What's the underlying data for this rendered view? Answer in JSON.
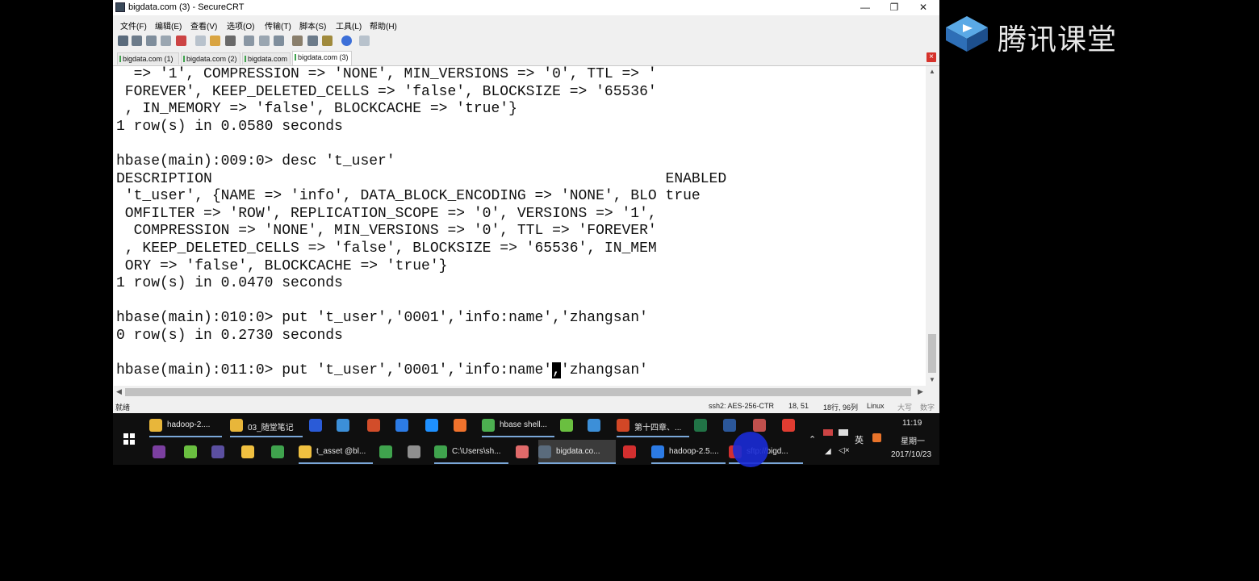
{
  "window": {
    "title": "bigdata.com (3) - SecureCRT",
    "controls": {
      "minimize": "—",
      "maximize": "❐",
      "close": "✕"
    }
  },
  "menu": [
    "文件(F)",
    "编辑(E)",
    "查看(V)",
    "选项(O)",
    "传输(T)",
    "脚本(S)",
    "工具(L)",
    "帮助(H)"
  ],
  "tabs": [
    "bigdata.com (1)",
    "bigdata.com (2)",
    "bigdata.com",
    "bigdata.com (3)"
  ],
  "terminal_lines": [
    "  => '1', COMPRESSION => 'NONE', MIN_VERSIONS => '0', TTL => '",
    " FOREVER', KEEP_DELETED_CELLS => 'false', BLOCKSIZE => '65536'",
    " , IN_MEMORY => 'false', BLOCKCACHE => 'true'}",
    "1 row(s) in 0.0580 seconds",
    "",
    "hbase(main):009:0> desc 't_user'",
    "DESCRIPTION                                                    ENABLED",
    " 't_user', {NAME => 'info', DATA_BLOCK_ENCODING => 'NONE', BLO true",
    " OMFILTER => 'ROW', REPLICATION_SCOPE => '0', VERSIONS => '1',",
    "  COMPRESSION => 'NONE', MIN_VERSIONS => '0', TTL => 'FOREVER'",
    " , KEEP_DELETED_CELLS => 'false', BLOCKSIZE => '65536', IN_MEM",
    " ORY => 'false', BLOCKCACHE => 'true'}",
    "1 row(s) in 0.0470 seconds",
    "",
    "hbase(main):010:0> put 't_user','0001','info:name','zhangsan'",
    "0 row(s) in 0.2730 seconds",
    ""
  ],
  "prompt_line": {
    "before_cursor": "hbase(main):011:0> put 't_user','0001','info:name'",
    "cursor_char": ",",
    "after_cursor": "'zhangsan'"
  },
  "status": {
    "ready": "就绪",
    "cipher": "ssh2: AES-256-CTR",
    "position": "18,  51",
    "rows_cols": "18行, 96列",
    "os": "Linux",
    "caps": "大写",
    "num": "数字"
  },
  "taskbar": {
    "top_row": [
      {
        "label": "hadoop-2....",
        "icon": "folder-icon",
        "color": "#e8b63a"
      },
      {
        "label": "03_随堂笔记",
        "icon": "folder-icon",
        "color": "#e8b63a"
      },
      {
        "label": "",
        "icon": "app-icon",
        "color": "#2a5bd7"
      },
      {
        "label": "",
        "icon": "network-icon",
        "color": "#3c8fd8"
      },
      {
        "label": "",
        "icon": "java-icon",
        "color": "#d24d2a"
      },
      {
        "label": "",
        "icon": "k-icon",
        "color": "#2c7be5"
      },
      {
        "label": "",
        "icon": "ie-icon",
        "color": "#1e90ff"
      },
      {
        "label": "",
        "icon": "firefox-icon",
        "color": "#f0722c"
      },
      {
        "label": "hbase shell...",
        "icon": "chrome-icon",
        "color": "#4caf50"
      },
      {
        "label": "",
        "icon": "green-app-icon",
        "color": "#6abf40"
      },
      {
        "label": "",
        "icon": "blue-app-icon",
        "color": "#3c8fd8"
      },
      {
        "label": "第十四章、...",
        "icon": "powerpoint-icon",
        "color": "#d24726"
      },
      {
        "label": "",
        "icon": "excel-icon",
        "color": "#217346"
      },
      {
        "label": "",
        "icon": "word-icon",
        "color": "#2b579a"
      },
      {
        "label": "",
        "icon": "tool-icon",
        "color": "#c0504d"
      },
      {
        "label": "",
        "icon": "xmind-icon",
        "color": "#e03c31"
      }
    ],
    "bottom_row": [
      {
        "label": "",
        "icon": "rp-icon",
        "color": "#7b3fa0"
      },
      {
        "label": "",
        "icon": "green-circle-icon",
        "color": "#6abf40"
      },
      {
        "label": "",
        "icon": "eclipse-icon",
        "color": "#5b4fa0"
      },
      {
        "label": "",
        "icon": "hand-icon",
        "color": "#f0c040"
      },
      {
        "label": "",
        "icon": "photo-icon",
        "color": "#3fa34d"
      },
      {
        "label": "t_asset @bl...",
        "icon": "navicat-icon",
        "color": "#f0c040"
      },
      {
        "label": "",
        "icon": "pycharm-icon",
        "color": "#3fa34d"
      },
      {
        "label": "",
        "icon": "jetbrains-icon",
        "color": "#8f8f8f"
      },
      {
        "label": "C:\\Users\\sh...",
        "icon": "cmd-icon",
        "color": "#3fa34d"
      },
      {
        "label": "",
        "icon": "eraser-icon",
        "color": "#e06a6a"
      },
      {
        "label": "bigdata.co...",
        "icon": "securecrt-icon",
        "color": "#5a6b7c"
      },
      {
        "label": "",
        "icon": "filezilla-icon",
        "color": "#d32f2f"
      },
      {
        "label": "hadoop-2.5....",
        "icon": "virtualbox-icon",
        "color": "#2c7be5"
      },
      {
        "label": "sftp://bigd...",
        "icon": "filezilla-icon",
        "color": "#d32f2f"
      }
    ],
    "tray": {
      "lang": "英",
      "time": "11:19",
      "weekday": "星期一",
      "date": "2017/10/23"
    }
  },
  "brand": {
    "name": "腾讯课堂"
  }
}
